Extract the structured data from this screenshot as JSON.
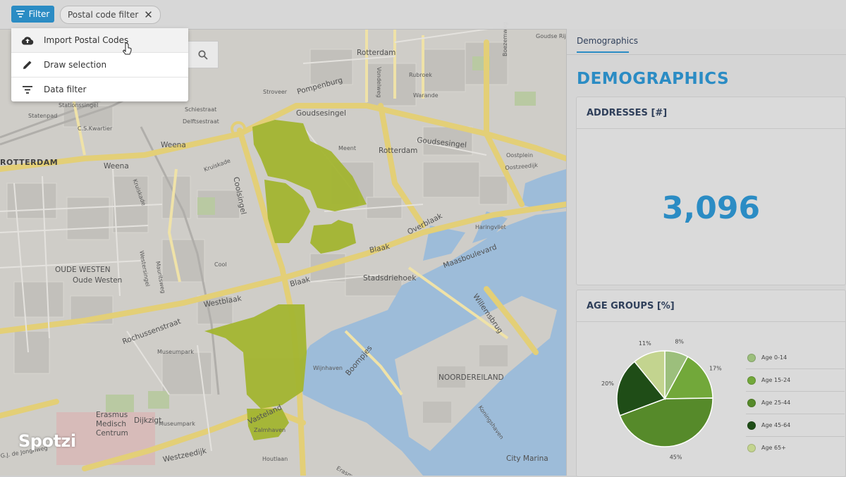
{
  "toolbar": {
    "filter_label": "Filter",
    "chip_label": "Postal code filter"
  },
  "menu": {
    "items": [
      {
        "label": "Import Postal Codes",
        "icon": "cloud-upload-icon"
      },
      {
        "label": "Draw selection",
        "icon": "pencil-icon"
      },
      {
        "label": "Data filter",
        "icon": "filter-lines-icon"
      }
    ]
  },
  "map": {
    "labels": [
      {
        "text": "Rotterdam",
        "cls": "mid"
      },
      {
        "text": "ROTTERDAM",
        "cls": "big"
      },
      {
        "text": "Rotterdam",
        "cls": "mid"
      },
      {
        "text": "OUDE WESTEN",
        "cls": "mid"
      },
      {
        "text": "Oude Westen",
        "cls": "mid"
      },
      {
        "text": "Stadsdriehoek",
        "cls": "mid"
      },
      {
        "text": "NOORDEREILAND",
        "cls": "mid"
      },
      {
        "text": "Dijkzigt",
        "cls": "mid"
      },
      {
        "text": "Erasmus",
        "cls": "mid"
      },
      {
        "text": "Medisch",
        "cls": "mid"
      },
      {
        "text": "Centrum",
        "cls": "mid"
      },
      {
        "text": "City Marina",
        "cls": "mid"
      },
      {
        "text": "C.S.Kwartier",
        "cls": "sm"
      },
      {
        "text": "Weena",
        "cls": "mid"
      },
      {
        "text": "Weena",
        "cls": "mid"
      },
      {
        "text": "Coolsingel",
        "cls": "mid"
      },
      {
        "text": "Goudsesingel",
        "cls": "mid"
      },
      {
        "text": "Goudsesingel",
        "cls": "mid"
      },
      {
        "text": "Pompenburg",
        "cls": "mid"
      },
      {
        "text": "Westblaak",
        "cls": "mid"
      },
      {
        "text": "Blaak",
        "cls": "mid"
      },
      {
        "text": "Blaak",
        "cls": "mid"
      },
      {
        "text": "Overblaak",
        "cls": "mid"
      },
      {
        "text": "Maasboulevard",
        "cls": "mid"
      },
      {
        "text": "Rochussenstraat",
        "cls": "mid"
      },
      {
        "text": "Vasteland",
        "cls": "mid"
      },
      {
        "text": "Westzeedijk",
        "cls": "mid"
      },
      {
        "text": "Boompjes",
        "cls": "mid"
      },
      {
        "text": "Willemsbrug",
        "cls": "mid"
      },
      {
        "text": "Oostzeedijk",
        "cls": "sm"
      },
      {
        "text": "Warande",
        "cls": "sm"
      },
      {
        "text": "Rubroek",
        "cls": "sm"
      },
      {
        "text": "Cool",
        "cls": "sm"
      },
      {
        "text": "Museumpark",
        "cls": "sm"
      },
      {
        "text": "Museumpark",
        "cls": "sm"
      },
      {
        "text": "Oostplein",
        "cls": "sm"
      },
      {
        "text": "Haringvliet",
        "cls": "sm"
      },
      {
        "text": "Wijnhaven",
        "cls": "sm"
      },
      {
        "text": "Meent",
        "cls": "sm"
      },
      {
        "text": "Stroveer",
        "cls": "sm"
      },
      {
        "text": "Schiestraat",
        "cls": "sm"
      },
      {
        "text": "Delftsestraat",
        "cls": "sm"
      },
      {
        "text": "Stationssingel",
        "cls": "sm"
      },
      {
        "text": "Statenpad",
        "cls": "sm"
      },
      {
        "text": "Kruiskade",
        "cls": "sm"
      },
      {
        "text": "Kruiskade",
        "cls": "sm"
      },
      {
        "text": "Mauritsweg",
        "cls": "sm"
      },
      {
        "text": "Westersingel",
        "cls": "sm"
      },
      {
        "text": "Goudse Rijweg",
        "cls": "sm"
      },
      {
        "text": "Boezemweg",
        "cls": "sm"
      },
      {
        "text": "Vondelweg",
        "cls": "sm"
      },
      {
        "text": "Zalmhaven",
        "cls": "sm"
      },
      {
        "text": "Houtlaan",
        "cls": "sm"
      },
      {
        "text": "Erasmusbrug",
        "cls": "sm"
      },
      {
        "text": "Koningshaven",
        "cls": "sm"
      },
      {
        "text": "G.J. de Jonghweg",
        "cls": "sm"
      }
    ]
  },
  "logo_text": "Spotzi",
  "panel": {
    "tab_label": "Demographics",
    "title": "DEMOGRAPHICS",
    "addresses": {
      "header": "ADDRESSES [#]",
      "value": "3,096"
    },
    "age_groups": {
      "header": "AGE GROUPS [%]"
    }
  },
  "chart_data": {
    "type": "pie",
    "title": "AGE GROUPS [%]",
    "categories": [
      "Age 0-14",
      "Age 15-24",
      "Age 25-44",
      "Age 45-64",
      "Age 65+"
    ],
    "values": [
      8,
      17,
      45,
      20,
      11
    ],
    "value_labels": [
      "8%",
      "17%",
      "45%",
      "20%",
      "11%"
    ],
    "colors": [
      "#9cbf7c",
      "#72a83a",
      "#568a2a",
      "#1f4d17",
      "#c3d48f"
    ],
    "legend_position": "right"
  }
}
